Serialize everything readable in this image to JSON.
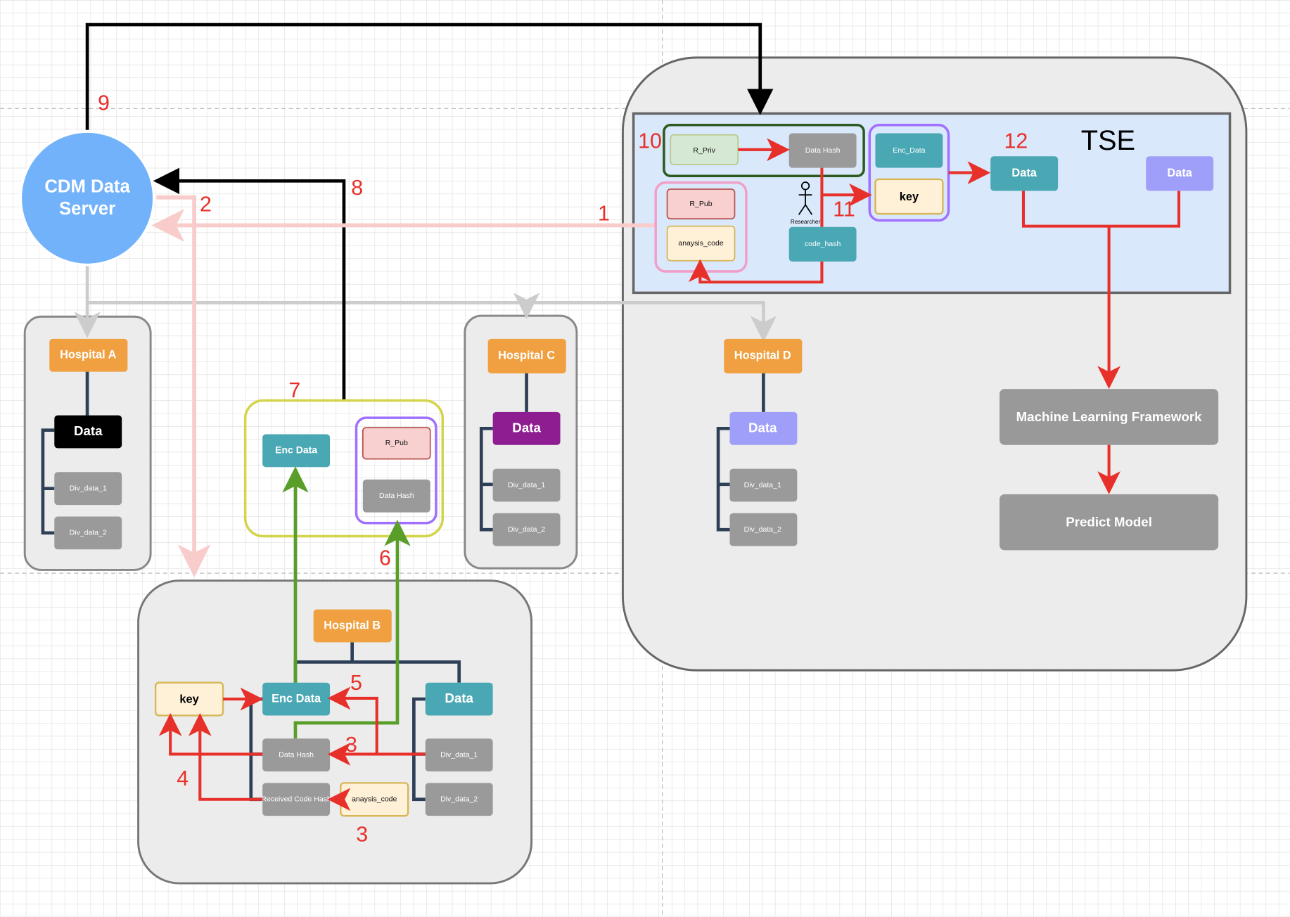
{
  "server": {
    "line1": "CDM Data",
    "line2": "Server"
  },
  "steps": [
    "1",
    "2",
    "3",
    "3",
    "4",
    "5",
    "6",
    "7",
    "8",
    "9",
    "10",
    "11",
    "12"
  ],
  "tse": {
    "title": "TSE",
    "r_priv": "R_Priv",
    "data_hash": "Data Hash",
    "r_pub": "R_Pub",
    "analysis_code": "anaysis_code",
    "researcher": "Researcher",
    "code_hash": "code_hash",
    "enc_data": "Enc_Data",
    "key": "key",
    "data1": "Data",
    "data2": "Data",
    "ml_framework": "Machine Learning Framework",
    "predict_model": "Predict Model"
  },
  "hospital_a": {
    "name": "Hospital A",
    "data": "Data",
    "div1": "Div_data_1",
    "div2": "Div_data_2"
  },
  "hospital_c": {
    "name": "Hospital C",
    "data": "Data",
    "div1": "Div_data_1",
    "div2": "Div_data_2"
  },
  "hospital_d": {
    "name": "Hospital D",
    "data": "Data",
    "div1": "Div_data_1",
    "div2": "Div_data_2"
  },
  "package": {
    "enc_data": "Enc Data",
    "r_pub": "R_Pub",
    "data_hash": "Data Hash"
  },
  "hospital_b": {
    "name": "Hospital B",
    "key": "key",
    "enc_data": "Enc Data",
    "data": "Data",
    "data_hash": "Data Hash",
    "received_code_hash": "Received Code Hash",
    "analysis_code": "anaysis_code",
    "div1": "Div_data_1",
    "div2": "Div_data_2"
  },
  "colors": {
    "red": "#e8302a",
    "pink": "#f9cccc",
    "green": "#5a9e2a",
    "teal": "#4aa8b5",
    "orange": "#f0a040",
    "lavender": "#9f9ffa",
    "purple": "#8e1d91",
    "server": "#72b2fb",
    "tree": "#2e4057"
  }
}
